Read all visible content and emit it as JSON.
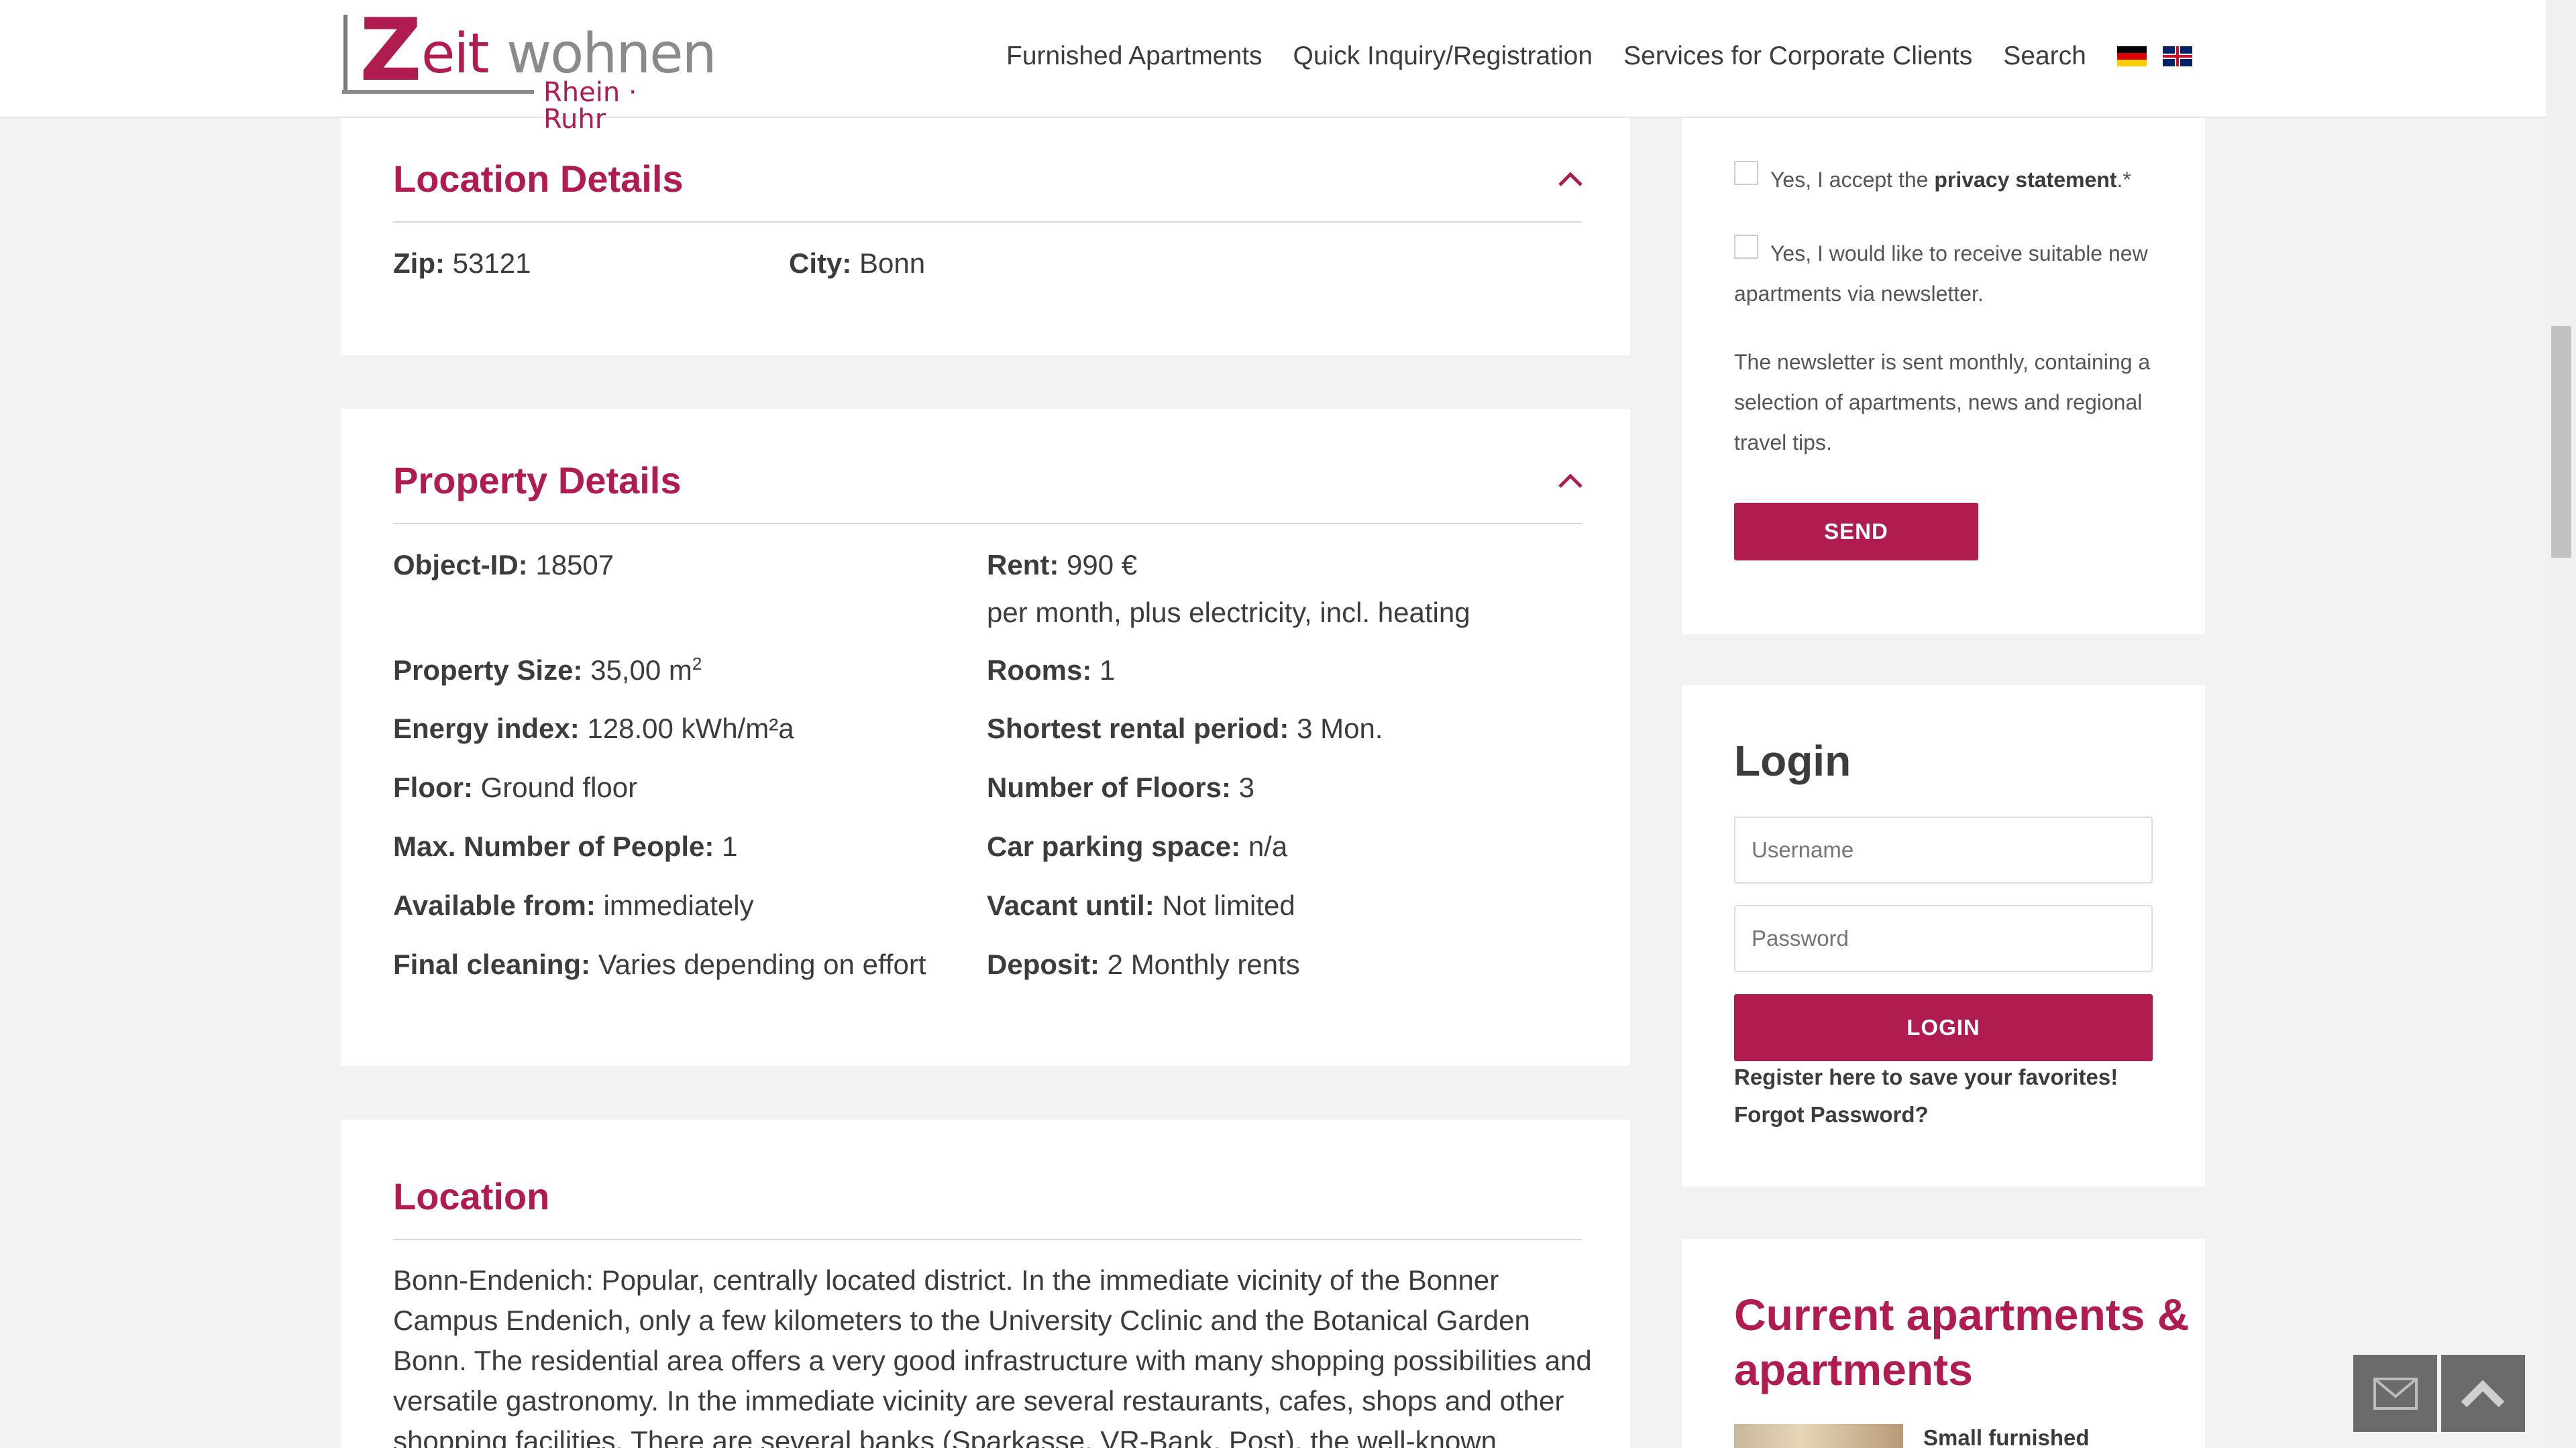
{
  "header": {
    "logo": {
      "main_z": "Z",
      "main_eit": "eit",
      "main_wohnen": "wohnen",
      "sub": "Rhein · Ruhr"
    },
    "nav": [
      {
        "label": "Furnished Apartments"
      },
      {
        "label": "Quick Inquiry/Registration"
      },
      {
        "label": "Services for Corporate Clients"
      },
      {
        "label": "Search"
      }
    ],
    "flags": [
      "german-flag-icon",
      "english-flag-icon"
    ]
  },
  "location_details": {
    "title": "Location Details",
    "zip_label": "Zip:",
    "zip_value": "53121",
    "city_label": "City:",
    "city_value": "Bonn"
  },
  "property_details": {
    "title": "Property Details",
    "left": [
      {
        "label": "Object-ID:",
        "value": "18507"
      },
      {
        "label": "Property Size:",
        "value": "35,00 m",
        "sup": "2"
      },
      {
        "label": "Energy index:",
        "value": "128.00 kWh/m²a"
      },
      {
        "label": "Floor:",
        "value": "Ground floor"
      },
      {
        "label": "Max. Number of People:",
        "value": "1"
      },
      {
        "label": "Available from:",
        "value": "immediately"
      },
      {
        "label": "Final cleaning:",
        "value": "Varies depending on effort"
      }
    ],
    "right": [
      {
        "label": "Rent:",
        "value": "990 €",
        "sub": "per month, plus electricity, incl. heating"
      },
      {
        "label": "Rooms:",
        "value": "1"
      },
      {
        "label": "Shortest rental period:",
        "value": "3 Mon."
      },
      {
        "label": "Number of Floors:",
        "value": "3"
      },
      {
        "label": "Car parking space:",
        "value": "n/a"
      },
      {
        "label": "Vacant until:",
        "value": "Not limited"
      },
      {
        "label": "Deposit:",
        "value": "2 Monthly rents"
      }
    ]
  },
  "location": {
    "title": "Location",
    "text": "Bonn-Endenich: Popular, centrally located district. In the immediate vicinity of the Bonner Campus Endenich, only a few kilometers to the University Cclinic and the Botanical Garden Bonn. The residential area offers a very good infrastructure with many shopping possibilities and versatile gastronomy. In the immediate vicinity are several restaurants, cafes, shops and other shopping facilities. There are several banks (Sparkasse, VR-Bank, Post), the well-known"
  },
  "sidebar": {
    "privacy_prefix": "Yes, I accept the ",
    "privacy_link": "privacy statement",
    "privacy_suffix": ".*",
    "newsletter_opt": "Yes, I would like to receive suitable new apartments via newsletter.",
    "newsletter_info": "The newsletter is sent monthly, containing a selection of apartments, news and regional travel tips.",
    "send_label": "SEND",
    "login": {
      "title": "Login",
      "username_placeholder": "Username",
      "password_placeholder": "Password",
      "button": "LOGIN",
      "register_link": "Register here to save your favorites!",
      "forgot_link": "Forgot Password?"
    },
    "current": {
      "title": "Current apartments & apartments",
      "first_item": "Small furnished"
    }
  },
  "colors": {
    "accent": "#b01c50",
    "text": "#3c3c3c",
    "background": "#f2f2f2"
  },
  "floating": {
    "mail": "mail-icon",
    "top": "chevron-up-icon"
  }
}
